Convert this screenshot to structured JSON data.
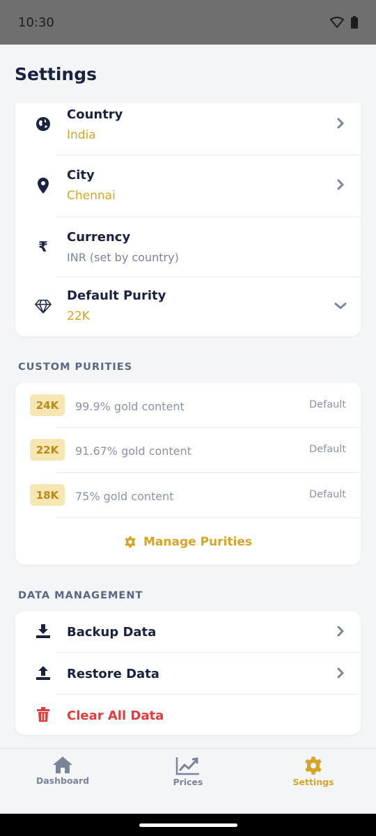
{
  "status_bar": {
    "time": "10:30",
    "wifi_icon": "wifi-icon",
    "battery_icon": "battery-icon"
  },
  "header": {
    "title": "Settings"
  },
  "location_settings": {
    "country": {
      "title": "Country",
      "value": "India"
    },
    "city": {
      "title": "City",
      "value": "Chennai"
    },
    "currency": {
      "title": "Currency",
      "value": "INR (set by country)"
    },
    "default_purity": {
      "title": "Default Purity",
      "value": "22K"
    }
  },
  "custom_purities": {
    "label": "CUSTOM PURITIES",
    "items": [
      {
        "badge": "24K",
        "description": "99.9% gold content",
        "tag": "Default"
      },
      {
        "badge": "22K",
        "description": "91.67% gold content",
        "tag": "Default"
      },
      {
        "badge": "18K",
        "description": "75% gold content",
        "tag": "Default"
      }
    ],
    "manage_label": "Manage Purities"
  },
  "data_management": {
    "label": "DATA MANAGEMENT",
    "backup": "Backup Data",
    "restore": "Restore Data",
    "clear": "Clear All Data"
  },
  "bottom_nav": {
    "dashboard": "Dashboard",
    "prices": "Prices",
    "settings": "Settings"
  },
  "colors": {
    "accent": "#d4a52a",
    "navy": "#1a2240",
    "danger": "#e33b3b",
    "badge_bg": "#f6e6b3"
  }
}
